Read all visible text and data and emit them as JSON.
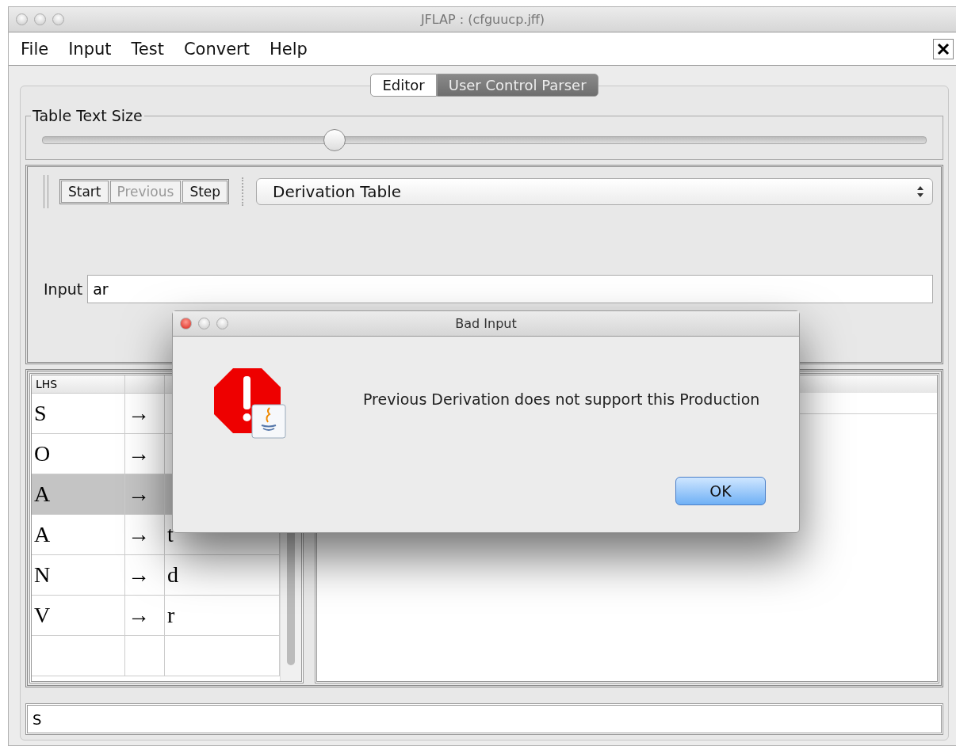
{
  "window": {
    "title": "JFLAP : (cfguucp.jff)"
  },
  "menu": [
    "File",
    "Input",
    "Test",
    "Convert",
    "Help"
  ],
  "tabs": [
    {
      "label": "Editor",
      "selected": false
    },
    {
      "label": "User Control Parser",
      "selected": true
    }
  ],
  "text_size": {
    "label": "Table Text Size",
    "level": 0.33
  },
  "toolbar": {
    "buttons": [
      {
        "label": "Start",
        "disabled": false
      },
      {
        "label": "Previous",
        "disabled": true
      },
      {
        "label": "Step",
        "disabled": false
      }
    ],
    "view": "Derivation Table"
  },
  "input": {
    "label": "Input",
    "value": "ar"
  },
  "grammar": {
    "columns": [
      "LHS"
    ],
    "rows": [
      {
        "lhs": "S",
        "arrow": "→",
        "selected": false
      },
      {
        "lhs": "O",
        "arrow": "→",
        "selected": false
      },
      {
        "lhs": "A",
        "arrow": "→",
        "selected": true
      },
      {
        "lhs": "A",
        "arrow": "→",
        "rhs": "t",
        "selected": false
      },
      {
        "lhs": "N",
        "arrow": "→",
        "rhs": "d",
        "selected": false
      },
      {
        "lhs": "V",
        "arrow": "→",
        "rhs": "r",
        "selected": false
      }
    ]
  },
  "derivation": "S",
  "dialog": {
    "title": "Bad Input",
    "message": "Previous Derivation does not support this Production",
    "button": "OK"
  }
}
